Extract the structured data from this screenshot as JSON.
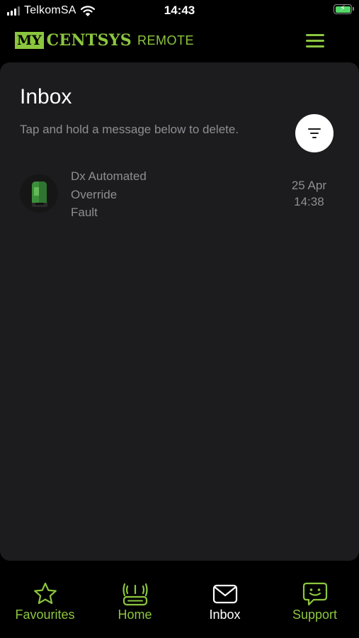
{
  "status_bar": {
    "carrier": "TelkomSA",
    "time": "14:43",
    "battery_icon": "battery-charging-icon"
  },
  "app_header": {
    "logo_my": "MY",
    "logo_brand": "CENTSYS",
    "logo_suffix": "REMOTE",
    "menu_icon": "hamburger-menu-icon"
  },
  "inbox": {
    "title": "Inbox",
    "hint": "Tap and hold a message below to delete.",
    "filter_icon": "filter-icon",
    "messages": [
      {
        "lines": [
          "Dx Automated",
          "Override",
          "Fault"
        ],
        "date": "25 Apr",
        "time": "14:38",
        "icon": "gate-motor-thumbnail"
      }
    ]
  },
  "tabs": [
    {
      "label": "Favourites",
      "icon": "star-icon",
      "active": false
    },
    {
      "label": "Home",
      "icon": "gate-remote-icon",
      "active": false
    },
    {
      "label": "Inbox",
      "icon": "envelope-icon",
      "active": true
    },
    {
      "label": "Support",
      "icon": "chat-smiley-icon",
      "active": false
    }
  ],
  "colors": {
    "accent": "#8cc63f",
    "background": "#000000",
    "card": "#1c1c1e",
    "muted_text": "#8e8e93",
    "active_tab": "#ffffff"
  }
}
